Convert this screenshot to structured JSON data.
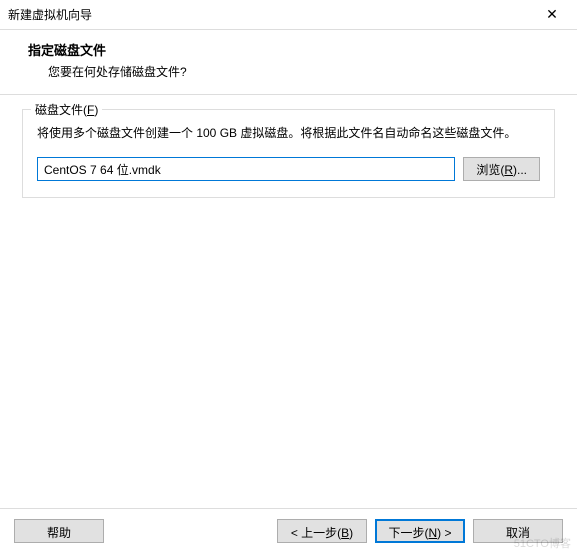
{
  "window": {
    "title": "新建虚拟机向导"
  },
  "header": {
    "title": "指定磁盘文件",
    "subtitle": "您要在何处存储磁盘文件?"
  },
  "group": {
    "label": "磁盘文件(F)",
    "description": "将使用多个磁盘文件创建一个 100 GB 虚拟磁盘。将根据此文件名自动命名这些磁盘文件。",
    "file_value": "CentOS 7 64 位.vmdk",
    "browse_label": "浏览(R)..."
  },
  "footer": {
    "help": "帮助",
    "back": "< 上一步(B)",
    "next": "下一步(N) >",
    "cancel": "取消"
  },
  "watermark": "51CTO博客"
}
